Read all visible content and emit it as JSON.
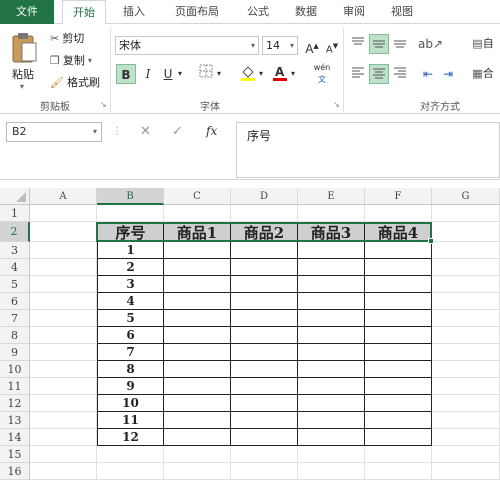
{
  "tabs": [
    "文件",
    "开始",
    "插入",
    "页面布局",
    "公式",
    "数据",
    "审阅",
    "视图"
  ],
  "clipboard": {
    "paste": "粘贴",
    "cut": "剪切",
    "copy": "复制",
    "format_painter": "格式刷",
    "group": "剪贴板"
  },
  "font": {
    "name": "宋体",
    "size": "14",
    "grow": "A",
    "shrink": "A",
    "bold": "B",
    "italic": "I",
    "underline": "U",
    "pinyin": "wén",
    "group": "字体"
  },
  "alignment": {
    "wrap": "自",
    "merge": "合",
    "group": "对齐方式"
  },
  "formula_bar": {
    "name_box": "B2",
    "fx": "fx",
    "content": "序号"
  },
  "sheet": {
    "columns": [
      "A",
      "B",
      "C",
      "D",
      "E",
      "F",
      "G"
    ],
    "selected_column": "B",
    "rows": [
      "1",
      "2",
      "3",
      "4",
      "5",
      "6",
      "7",
      "8",
      "9",
      "10",
      "11",
      "12",
      "13",
      "14",
      "15",
      "16"
    ],
    "selected_row": "2",
    "table_header": [
      "序号",
      "商品1",
      "商品2",
      "商品3",
      "商品4"
    ],
    "serials": [
      "1",
      "2",
      "3",
      "4",
      "5",
      "6",
      "7",
      "8",
      "9",
      "10",
      "11",
      "12"
    ]
  },
  "colors": {
    "accent": "#217346",
    "selection_fill": "#cfcfcf"
  }
}
